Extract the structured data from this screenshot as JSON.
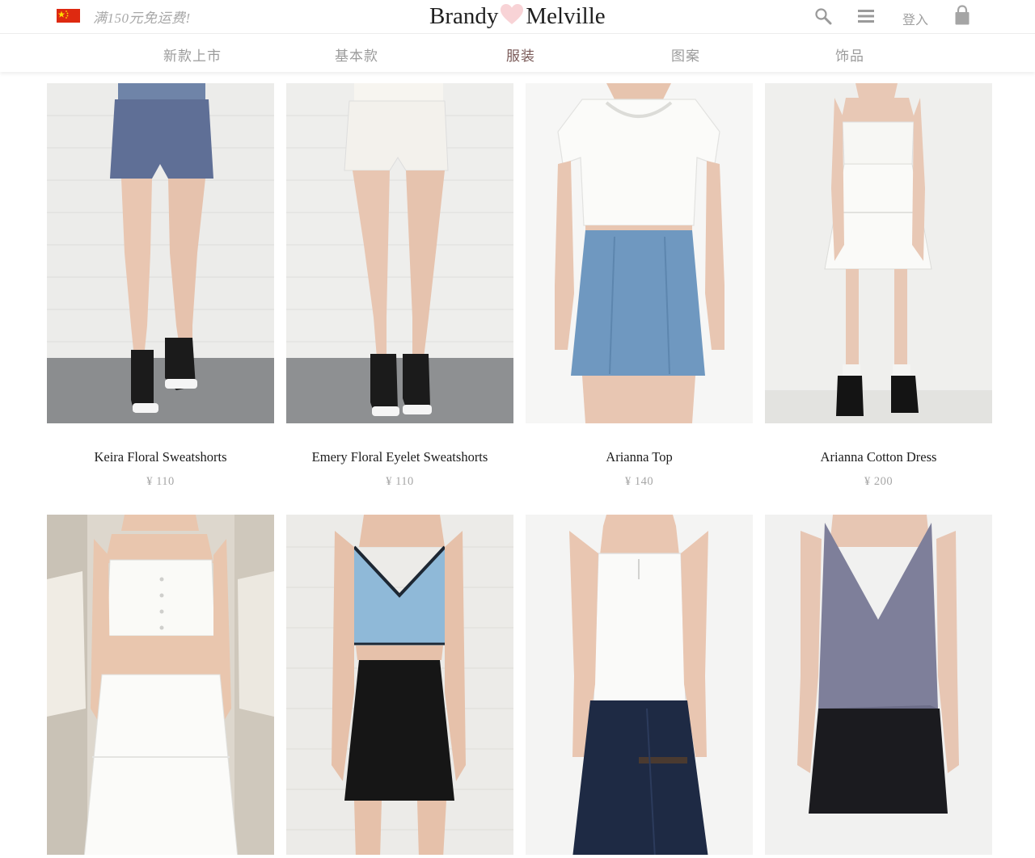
{
  "header": {
    "promo": "满150元免运费!",
    "brand_left": "Brandy",
    "brand_right": "Melville",
    "login": "登入"
  },
  "nav": {
    "items": [
      {
        "label": "新款上市"
      },
      {
        "label": "基本款"
      },
      {
        "label": "服装",
        "active": true
      },
      {
        "label": "图案"
      },
      {
        "label": "饰品"
      }
    ]
  },
  "products": [
    {
      "name": "Keira Floral Sweatshorts",
      "price": "¥ 110"
    },
    {
      "name": "Emery Floral Eyelet Sweatshorts",
      "price": "¥ 110"
    },
    {
      "name": "Arianna Top",
      "price": "¥ 140"
    },
    {
      "name": "Arianna Cotton Dress",
      "price": "¥ 200"
    },
    {
      "name": "",
      "price": ""
    },
    {
      "name": "",
      "price": ""
    },
    {
      "name": "",
      "price": ""
    },
    {
      "name": "",
      "price": ""
    }
  ],
  "colors": {
    "accent_nav_active": "#7a5a58",
    "heart_pink": "#f6c9cc",
    "muted_text": "#a6a6a6"
  },
  "icons": [
    "flag-icon",
    "heart-icon",
    "search-icon",
    "menu-icon",
    "shopping-bag-icon"
  ]
}
